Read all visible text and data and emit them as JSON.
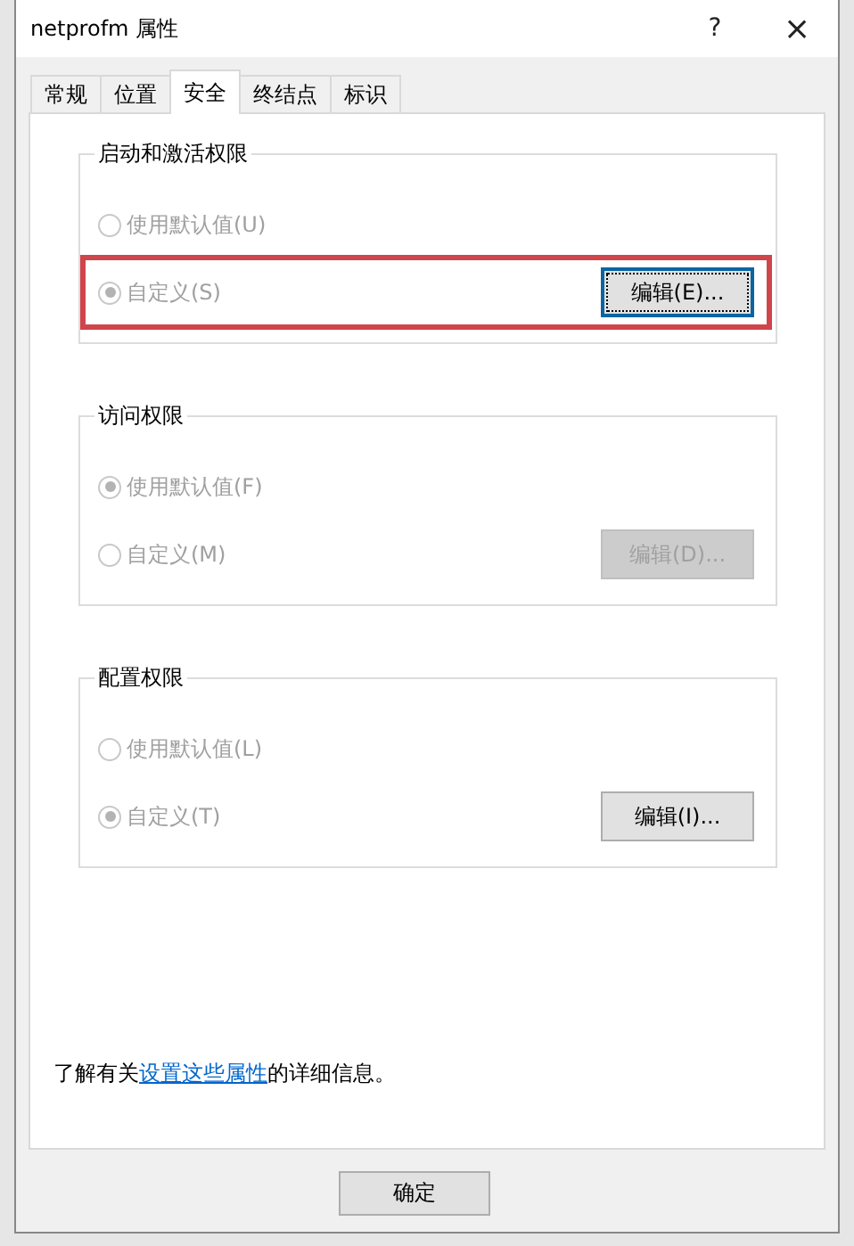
{
  "window": {
    "title": "netprofm 属性",
    "help": "?",
    "close": "×"
  },
  "tabs": [
    {
      "label": "常规",
      "selected": false
    },
    {
      "label": "位置",
      "selected": false
    },
    {
      "label": "安全",
      "selected": true
    },
    {
      "label": "终结点",
      "selected": false
    },
    {
      "label": "标识",
      "selected": false
    }
  ],
  "groups": [
    {
      "title": "启动和激活权限",
      "options": [
        {
          "label": "使用默认值(U)",
          "selected": false,
          "disabled": true,
          "highlighted": false
        },
        {
          "label": "自定义(S)",
          "selected": true,
          "disabled": true,
          "highlighted": true
        }
      ],
      "edit_button": {
        "label": "编辑(E)...",
        "disabled": false,
        "focused": true
      }
    },
    {
      "title": "访问权限",
      "options": [
        {
          "label": "使用默认值(F)",
          "selected": true,
          "disabled": true,
          "highlighted": false
        },
        {
          "label": "自定义(M)",
          "selected": false,
          "disabled": true,
          "highlighted": false
        }
      ],
      "edit_button": {
        "label": "编辑(D)...",
        "disabled": true,
        "focused": false
      }
    },
    {
      "title": "配置权限",
      "options": [
        {
          "label": "使用默认值(L)",
          "selected": false,
          "disabled": true,
          "highlighted": false
        },
        {
          "label": "自定义(T)",
          "selected": true,
          "disabled": true,
          "highlighted": false
        }
      ],
      "edit_button": {
        "label": "编辑(I)...",
        "disabled": false,
        "focused": false
      }
    }
  ],
  "info": {
    "before": "了解有关",
    "link": "设置这些属性",
    "after": "的详细信息。"
  },
  "buttons": [
    "确定"
  ]
}
